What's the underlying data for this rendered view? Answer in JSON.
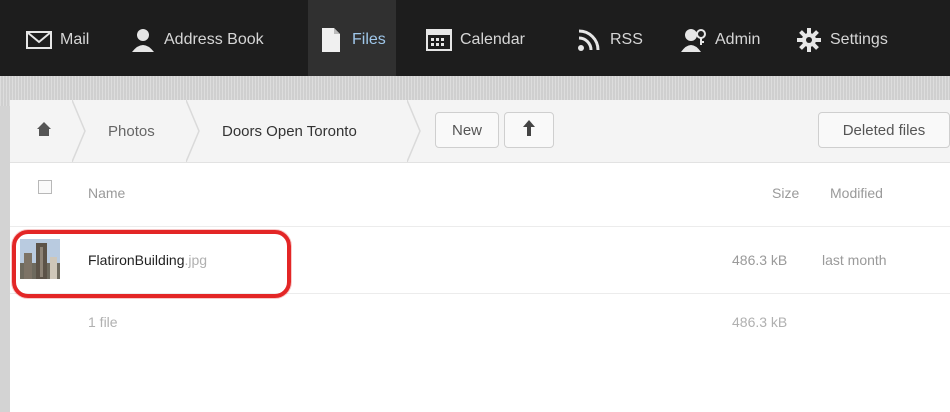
{
  "nav": {
    "items": [
      {
        "label": "Mail",
        "icon": "mail-icon"
      },
      {
        "label": "Address Book",
        "icon": "user-icon"
      },
      {
        "label": "Files",
        "icon": "file-icon",
        "active": true
      },
      {
        "label": "Calendar",
        "icon": "calendar-icon"
      },
      {
        "label": "RSS",
        "icon": "rss-icon"
      },
      {
        "label": "Admin",
        "icon": "admin-icon"
      },
      {
        "label": "Settings",
        "icon": "gear-icon"
      }
    ]
  },
  "breadcrumb": {
    "home_icon": "home-icon",
    "items": [
      "Photos",
      "Doors Open Toronto"
    ]
  },
  "controls": {
    "new_label": "New",
    "upload_icon": "upload-arrow-icon",
    "deleted_label": "Deleted files"
  },
  "table": {
    "headers": {
      "name": "Name",
      "size": "Size",
      "modified": "Modified"
    },
    "rows": [
      {
        "name": "FlatironBuilding",
        "ext": ".jpg",
        "size": "486.3 kB",
        "modified": "last month"
      }
    ],
    "summary": {
      "count": "1 file",
      "size": "486.3 kB"
    }
  },
  "colors": {
    "highlight": "#e32626",
    "active_nav": "#9fc7ea"
  }
}
